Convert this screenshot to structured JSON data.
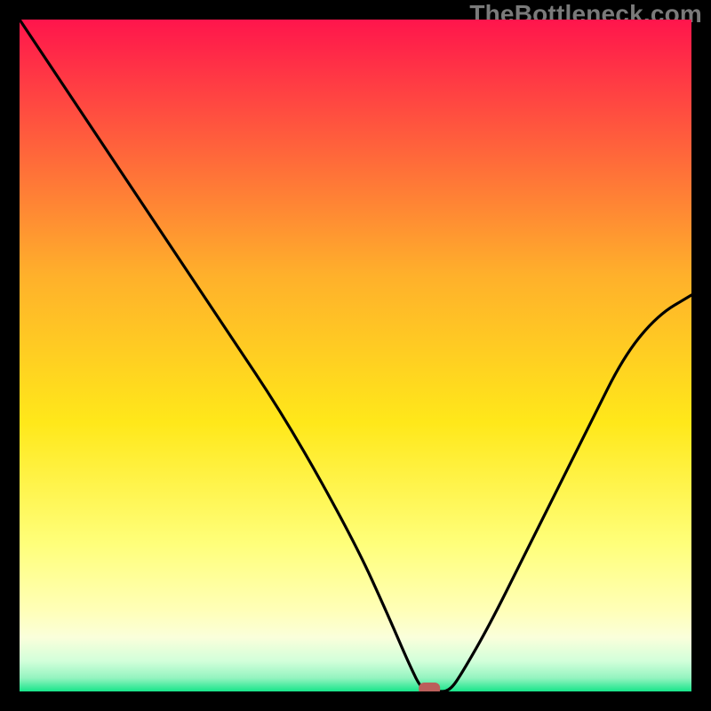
{
  "watermark": "TheBottleneck.com",
  "chart_data": {
    "type": "line",
    "title": "",
    "xlabel": "",
    "ylabel": "",
    "xlim": [
      0,
      100
    ],
    "ylim": [
      0,
      100
    ],
    "grid": false,
    "series": [
      {
        "name": "curve",
        "x": [
          0,
          10,
          20,
          30,
          40,
          50,
          55,
          58,
          60,
          62,
          64,
          66,
          70,
          75,
          80,
          85,
          90,
          95,
          100
        ],
        "y": [
          100,
          85,
          70,
          55,
          40,
          22,
          11,
          4,
          0,
          0,
          0,
          3,
          10,
          20,
          30,
          40,
          50,
          56,
          59
        ],
        "color": "#000000"
      }
    ],
    "marker": {
      "x": 61,
      "y": 0,
      "color": "#bb5f5b"
    },
    "background_gradient": {
      "top": "#ff154c",
      "mid_upper": "#ffb02b",
      "mid": "#ffe81a",
      "mid_lower": "#ffff7a",
      "lower1": "#faffdb",
      "lower2": "#d2ffda",
      "lower3": "#94f4c0",
      "bottom": "#17e58a"
    }
  }
}
